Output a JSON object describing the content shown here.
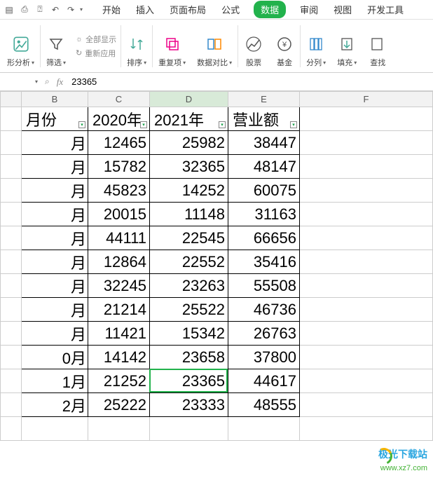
{
  "qa_icons": [
    "save",
    "print",
    "preview",
    "undo",
    "redo"
  ],
  "tabs": {
    "items": [
      "开始",
      "插入",
      "页面布局",
      "公式",
      "数据",
      "审阅",
      "视图",
      "开发工具"
    ],
    "active_index": 4
  },
  "ribbon": {
    "analysis": "形分析",
    "filter": "筛选",
    "show_all": "全部显示",
    "reapply": "重新应用",
    "sort": "排序",
    "duplicates": "重复项",
    "data_compare": "数据对比",
    "stocks": "股票",
    "funds": "基金",
    "split": "分列",
    "fill": "填充",
    "lookup": "查找"
  },
  "formula_bar": {
    "name": "",
    "value": "23365"
  },
  "columns": [
    "B",
    "C",
    "D",
    "E",
    "F"
  ],
  "active_col_index": 2,
  "headers": {
    "b": "月份",
    "c": "2020年",
    "d": "2021年",
    "e": "营业额"
  },
  "chart_data": {
    "type": "table",
    "title": "",
    "columns": [
      "月份",
      "2020年",
      "2021年",
      "营业额"
    ],
    "rows": [
      {
        "month": "月",
        "y2020": 12465,
        "y2021": 25982,
        "rev": 38447
      },
      {
        "month": "月",
        "y2020": 15782,
        "y2021": 32365,
        "rev": 48147
      },
      {
        "month": "月",
        "y2020": 45823,
        "y2021": 14252,
        "rev": 60075
      },
      {
        "month": "月",
        "y2020": 20015,
        "y2021": 11148,
        "rev": 31163
      },
      {
        "month": "月",
        "y2020": 44111,
        "y2021": 22545,
        "rev": 66656
      },
      {
        "month": "月",
        "y2020": 12864,
        "y2021": 22552,
        "rev": 35416
      },
      {
        "month": "月",
        "y2020": 32245,
        "y2021": 23263,
        "rev": 55508
      },
      {
        "month": "月",
        "y2020": 21214,
        "y2021": 25522,
        "rev": 46736
      },
      {
        "month": "月",
        "y2020": 11421,
        "y2021": 15342,
        "rev": 26763
      },
      {
        "month": "0月",
        "y2020": 14142,
        "y2021": 23658,
        "rev": 37800
      },
      {
        "month": "1月",
        "y2020": 21252,
        "y2021": 23365,
        "rev": 44617
      },
      {
        "month": "2月",
        "y2020": 25222,
        "y2021": 23333,
        "rev": 48555
      }
    ]
  },
  "active_cell": {
    "col": "D",
    "row_index": 10
  },
  "watermark": {
    "line1": "极光下载站",
    "line2": "www.xz7.com"
  }
}
